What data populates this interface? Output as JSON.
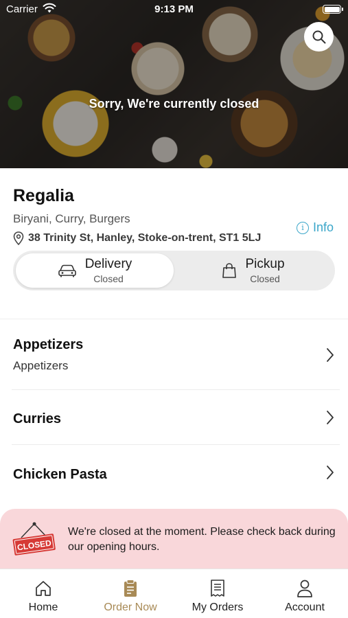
{
  "status_bar": {
    "carrier": "Carrier",
    "time": "9:13 PM"
  },
  "hero": {
    "closed_message": "Sorry, We're currently closed"
  },
  "restaurant": {
    "name": "Regalia",
    "cuisine": "Biryani, Curry, Burgers",
    "address": "38 Trinity St, Hanley, Stoke-on-trent, ST1 5LJ",
    "info_label": "Info",
    "info_icon_glyph": "i"
  },
  "order_modes": [
    {
      "title": "Delivery",
      "status": "Closed",
      "selected": true,
      "icon": "car-icon"
    },
    {
      "title": "Pickup",
      "status": "Closed",
      "selected": false,
      "icon": "bag-icon"
    }
  ],
  "categories": [
    {
      "title": "Appetizers",
      "subtitle": "Appetizers"
    },
    {
      "title": "Curries",
      "subtitle": ""
    },
    {
      "title": "Chicken Pasta",
      "subtitle": ""
    }
  ],
  "closed_banner": {
    "sign_text": "CLOSED",
    "message": "We're closed at the moment. Please check back during our opening hours."
  },
  "tabs": [
    {
      "label": "Home",
      "icon": "home-icon",
      "active": false
    },
    {
      "label": "Order Now",
      "icon": "order-icon",
      "active": true
    },
    {
      "label": "My Orders",
      "icon": "receipt-icon",
      "active": false
    },
    {
      "label": "Account",
      "icon": "person-icon",
      "active": false
    }
  ],
  "colors": {
    "accent": "#a88a56",
    "info": "#3aa6c9",
    "closed_banner_bg": "#f9d7da",
    "closed_sign": "#d63a36"
  }
}
